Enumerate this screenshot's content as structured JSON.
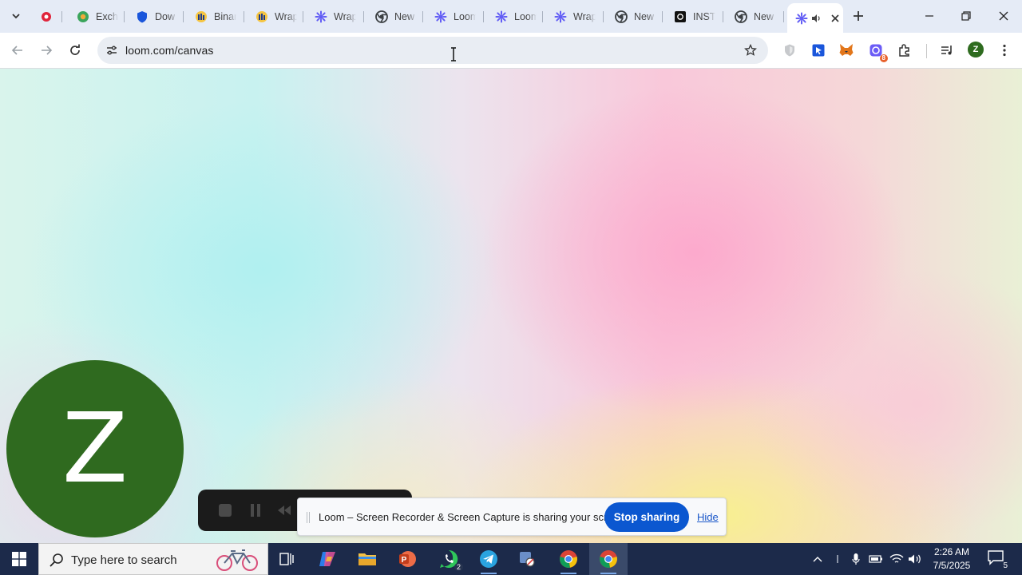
{
  "browser": {
    "tabs": [
      {
        "title": "",
        "icon": "record-icon",
        "color": "#e0243b"
      },
      {
        "title": "Exch",
        "icon": "exchange-icon",
        "color": "#3ba55c"
      },
      {
        "title": "Dow",
        "icon": "shield-icon",
        "color": "#1a56db"
      },
      {
        "title": "Binar",
        "icon": "binaryx-icon",
        "color": "#1e3a8a"
      },
      {
        "title": "Wrap",
        "icon": "binaryx-icon",
        "color": "#1e3a8a"
      },
      {
        "title": "Wrap",
        "icon": "loom-icon",
        "color": "#625df5"
      },
      {
        "title": "New",
        "icon": "chrome-icon",
        "color": "#3c4043"
      },
      {
        "title": "Loom",
        "icon": "loom-icon",
        "color": "#625df5"
      },
      {
        "title": "Loom",
        "icon": "loom-icon",
        "color": "#625df5"
      },
      {
        "title": "Wrap",
        "icon": "loom-icon",
        "color": "#625df5"
      },
      {
        "title": "New",
        "icon": "chrome-icon",
        "color": "#3c4043"
      },
      {
        "title": "INST",
        "icon": "insta-icon",
        "color": "#111111"
      },
      {
        "title": "New",
        "icon": "chrome-icon",
        "color": "#3c4043"
      }
    ],
    "active_tab": {
      "icon": "loom-icon",
      "audio_icon": "speaker-icon"
    },
    "url": "loom.com/canvas",
    "profile_initial": "Z",
    "extension_badge": "8"
  },
  "camera": {
    "initial": "Z",
    "color": "#2f6a1f"
  },
  "sharing": {
    "message": "Loom – Screen Recorder & Screen Capture is sharing your screen.",
    "stop_label": "Stop sharing",
    "hide_label": "Hide"
  },
  "taskbar": {
    "search_placeholder": "Type here to search",
    "whatsapp_count": "2",
    "time": "2:26 AM",
    "date": "7/5/2025",
    "notification_count": "5"
  }
}
